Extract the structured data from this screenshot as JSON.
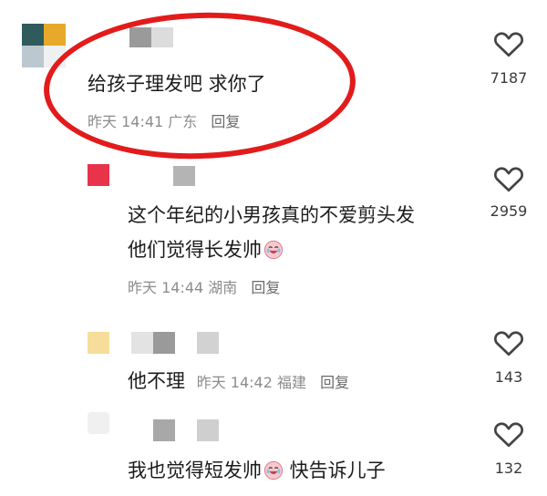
{
  "colors": {
    "highlight_circle": "#e21b1b",
    "meta_text": "#8c8c8c"
  },
  "comments": [
    {
      "text": "给孩子理发吧 求你了",
      "time": "昨天 14:41",
      "location": "广东",
      "reply": "回复",
      "likes": "7187"
    },
    {
      "text_line1": "这个年纪的小男孩真的不爱剪头发",
      "text_line2": "他们觉得长发帅",
      "emoji": "crying-laughing-emoji",
      "time": "昨天 14:44",
      "location": "湖南",
      "reply": "回复",
      "likes": "2959"
    },
    {
      "text": "他不理",
      "time": "昨天 14:42",
      "location": "福建",
      "reply": "回复",
      "likes": "143"
    },
    {
      "text_before": "我也觉得短发帅",
      "emoji": "crying-laughing-emoji",
      "text_after": " 快告诉儿子",
      "likes": "132"
    }
  ]
}
